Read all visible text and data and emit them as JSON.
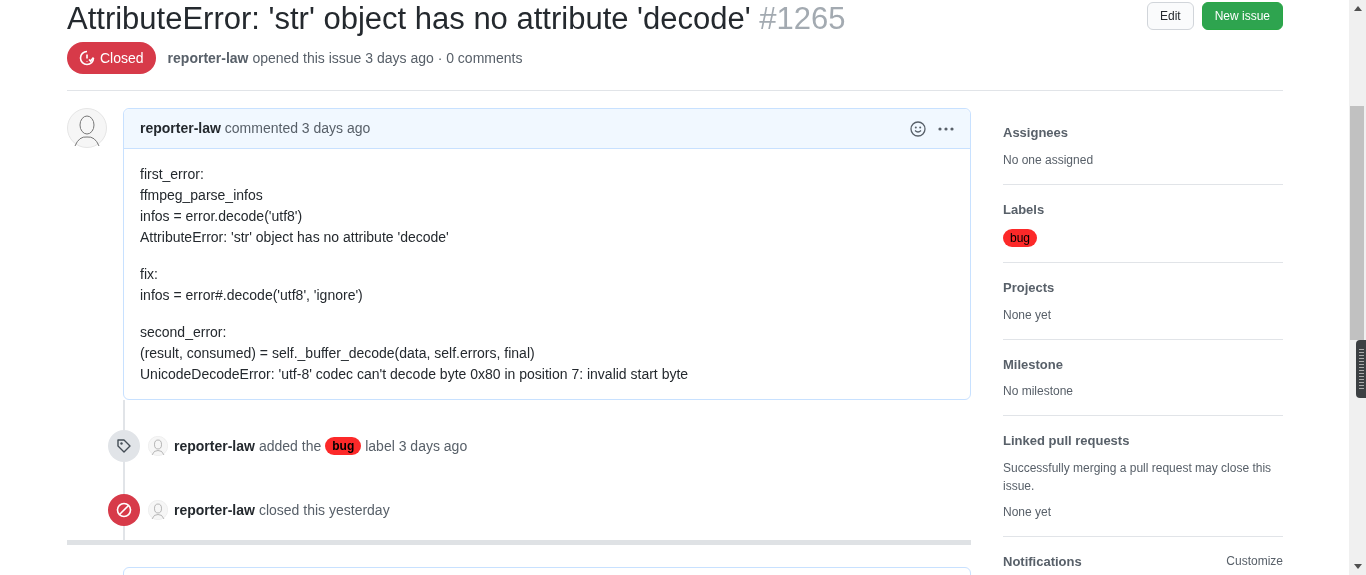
{
  "issue": {
    "title": "AttributeError: 'str' object has no attribute 'decode'",
    "number": "#1265",
    "closed": true,
    "state_label": "Closed",
    "author": "reporter-law",
    "meta": "opened this issue 3 days ago · 0 comments"
  },
  "buttons": [
    {
      "label": "Edit",
      "kind": "secondary"
    },
    {
      "label": "New issue",
      "kind": "primary"
    }
  ],
  "comment": {
    "author": "reporter-law",
    "action": "commented 3 days ago",
    "paragraphs": [
      [
        "first_error:",
        "ffmpeg_parse_infos",
        "infos = error.decode('utf8')",
        "AttributeError: 'str' object has no attribute 'decode'"
      ],
      [
        "fix:",
        "infos = error#.decode('utf8', 'ignore')"
      ],
      [
        "second_error:",
        "(result, consumed) = self._buffer_decode(data, self.errors, final)",
        "UnicodeDecodeError: 'utf-8' codec can't decode byte 0x80 in position 7: invalid start byte"
      ]
    ]
  },
  "timeline": [
    {
      "kind": "labeled",
      "author": "reporter-law",
      "before": "added the",
      "label": {
        "name": "bug",
        "color": "#fc2929"
      },
      "after": "label 3 days ago"
    },
    {
      "kind": "closed",
      "author": "reporter-law",
      "before": "closed this yesterday"
    }
  ],
  "sidebar": [
    {
      "heading": "Assignees",
      "lines": [
        "No one assigned"
      ]
    },
    {
      "heading": "Labels",
      "labels": [
        {
          "name": "bug",
          "color": "#fc2929"
        }
      ]
    },
    {
      "heading": "Projects",
      "lines": [
        "None yet"
      ]
    },
    {
      "heading": "Milestone",
      "lines": [
        "No milestone"
      ]
    },
    {
      "heading": "Linked pull requests",
      "lines": [
        "Successfully merging a pull request may close this issue.",
        "None yet"
      ]
    },
    {
      "heading": "Notifications",
      "action": "Customize"
    }
  ]
}
